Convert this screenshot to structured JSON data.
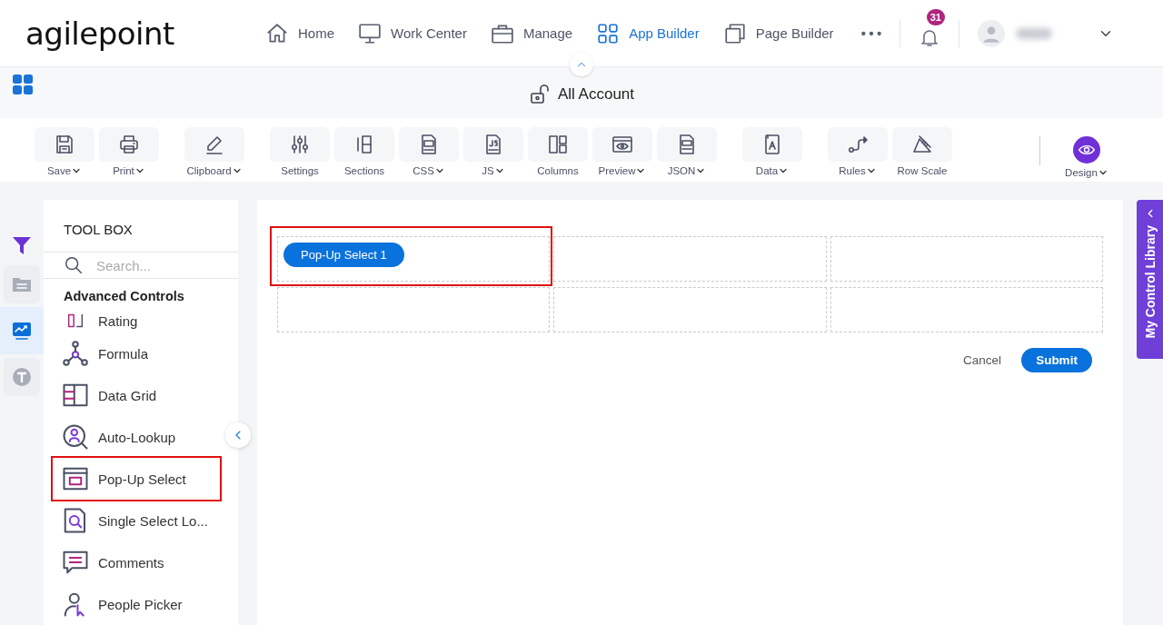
{
  "header": {
    "logo": "agilepoint",
    "nav": [
      {
        "label": "Home",
        "selected": false
      },
      {
        "label": "Work Center",
        "selected": false
      },
      {
        "label": "Manage",
        "selected": false
      },
      {
        "label": "App Builder",
        "selected": true
      },
      {
        "label": "Page Builder",
        "selected": false
      }
    ],
    "notification_count": "31"
  },
  "title_bar": {
    "title": "All Account"
  },
  "toolbar": {
    "groups": [
      {
        "tools": [
          {
            "label": "Save",
            "dropdown": true
          },
          {
            "label": "Print",
            "dropdown": true
          }
        ]
      },
      {
        "tools": [
          {
            "label": "Clipboard",
            "dropdown": true
          }
        ]
      },
      {
        "tools": [
          {
            "label": "Settings",
            "dropdown": false
          },
          {
            "label": "Sections",
            "dropdown": false
          },
          {
            "label": "CSS",
            "dropdown": true
          },
          {
            "label": "JS",
            "dropdown": true
          },
          {
            "label": "Columns",
            "dropdown": false
          },
          {
            "label": "Preview",
            "dropdown": true
          },
          {
            "label": "JSON",
            "dropdown": true
          }
        ]
      },
      {
        "tools": [
          {
            "label": "Data",
            "dropdown": true
          }
        ]
      },
      {
        "tools": [
          {
            "label": "Rules",
            "dropdown": true
          },
          {
            "label": "Row Scale",
            "dropdown": false
          }
        ]
      }
    ],
    "mode": {
      "label": "Design",
      "dropdown": true
    }
  },
  "rail": [
    {
      "selected": false
    },
    {
      "selected": false
    },
    {
      "selected": true
    },
    {
      "selected": false
    }
  ],
  "toolbox": {
    "title": "TOOL BOX",
    "search_placeholder": "Search...",
    "section": "Advanced Controls",
    "items": [
      {
        "label": "Rating",
        "highlighted": false
      },
      {
        "label": "Formula",
        "highlighted": false
      },
      {
        "label": "Data Grid",
        "highlighted": false
      },
      {
        "label": "Auto-Lookup",
        "highlighted": false
      },
      {
        "label": "Pop-Up Select",
        "highlighted": true
      },
      {
        "label": "Single Select Lo...",
        "highlighted": false
      },
      {
        "label": "Comments",
        "highlighted": false
      },
      {
        "label": "People Picker",
        "highlighted": false
      }
    ]
  },
  "form": {
    "cells": [
      {
        "control": "Pop-Up Select 1",
        "highlighted": true
      },
      {
        "highlighted": false
      },
      {
        "highlighted": false
      },
      {
        "highlighted": false
      },
      {
        "highlighted": false
      },
      {
        "highlighted": false
      }
    ],
    "cancel": "Cancel",
    "submit": "Submit"
  },
  "side_tab": {
    "label": "My Control Library"
  }
}
